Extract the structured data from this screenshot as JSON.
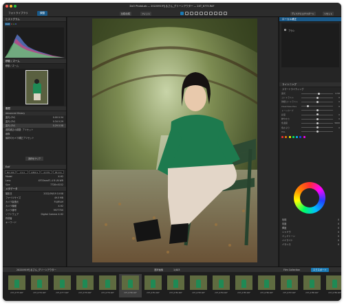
{
  "window": {
    "title": "DxO PhotoLab — 20220919もるさん_グリーンアウター — 2XT_6775.RAF"
  },
  "colors": {
    "accent": "#1a7ab5",
    "tab_active": "#1a5a8a",
    "close": "#ff5f57",
    "minimize": "#febc2e",
    "zoom": "#28c840"
  },
  "tabs": {
    "library": "フォトライブラリ",
    "customize": "調整"
  },
  "toolbar": {
    "compare_label": "比較/比較",
    "fit_label": "フィット",
    "export_to_disk": "ディスクにエクスポート",
    "reset_label": "リセット"
  },
  "left": {
    "histogram_title": "ヒストグラム",
    "histogram_tags": [
      "RGB",
      "R",
      "G",
      "B"
    ],
    "move_zoom_title": "移動 / ズーム",
    "navigator_label": "移動 / ズーム",
    "history_title": "履歴",
    "history_tab": "Advanced History",
    "history_items": [
      {
        "label": "露光 (EV)",
        "a": "0.00",
        "b": "0.34"
      },
      {
        "label": "露光 (EV)",
        "a": "0.34",
        "b": "0.29"
      },
      {
        "label": "露光 (EV)",
        "a": "0.29",
        "b": "0.58"
      },
      {
        "label": "透視補正の調整: プリセット",
        "a": "",
        "b": ""
      },
      {
        "label": "画像",
        "a": "",
        "b": ""
      },
      {
        "label": "最初のカメラ補正プリセット",
        "a": "",
        "b": ""
      }
    ],
    "history_button": "選択をクリア",
    "exif_title": "Exif",
    "exif_fields": [
      "ISO 100",
      "f/1.4",
      "1/800 s",
      "-1/3 EV",
      "85 mm"
    ],
    "exif_lines": [
      {
        "k": "Model",
        "v": "X-H2"
      },
      {
        "k": "Lens",
        "v": "XF33mmF1.4 R LM WR"
      },
      {
        "k": "Size",
        "v": "7728×5152"
      }
    ],
    "info_title": "メタデータ",
    "info_rows": [
      {
        "k": "撮影日",
        "v": "2022/09/19 10:58"
      },
      {
        "k": "ファイルサイズ",
        "v": "49.5 MB"
      },
      {
        "k": "カメラ製造元",
        "v": "FUJIFILM"
      },
      {
        "k": "カメラ機種",
        "v": "X-H2"
      },
      {
        "k": "カメラ番号",
        "v": "9977700"
      },
      {
        "k": "ソフトウェア",
        "v": "Digital Camera X-H2"
      },
      {
        "k": "作成者",
        "v": ""
      },
      {
        "k": "キーワード",
        "v": ""
      }
    ]
  },
  "right": {
    "header_tab": "ローカル補正",
    "local_label": "ブラシ",
    "section_title": "ライトニング",
    "section_sub": "スマートライティング",
    "sliders": [
      {
        "label": "露光",
        "value": "0.58",
        "pos": 0.55
      },
      {
        "label": "コントラスト",
        "value": "0",
        "pos": 0.5
      },
      {
        "label": "微細コントラスト",
        "value": "0",
        "pos": 0.5
      },
      {
        "label": "ClearView Plus",
        "value": "0",
        "pos": 0.2
      },
      {
        "label": "トーンカーブ",
        "value": "",
        "pos": 0.5
      },
      {
        "label": "彩度",
        "value": "0",
        "pos": 0.5
      },
      {
        "label": "鮮やかさ",
        "value": "0",
        "pos": 0.5
      },
      {
        "label": "色温度",
        "value": "5600",
        "pos": 0.5
      },
      {
        "label": "色かぶり",
        "value": "0",
        "pos": 0.5
      },
      {
        "label": "HSL",
        "value": "",
        "pos": 0.5
      }
    ],
    "color_labels": [
      "色相",
      "彩度",
      "輝度"
    ],
    "bottom_rows": [
      {
        "label": "シャドウ",
        "value": "0"
      },
      {
        "label": "ミッドトーン",
        "value": "0"
      },
      {
        "label": "ハイライト",
        "value": "0"
      },
      {
        "label": "バランス",
        "value": "0"
      }
    ]
  },
  "bottom": {
    "folder": "20220919もるさん_グリーンアウター",
    "count": "1/403",
    "selected": "選択画像",
    "filmpack_label": "Film Collection",
    "export_button": "エクスポート"
  },
  "thumbnails": [
    "2XT_6775.RAF",
    "2XT_6776.RAF",
    "2XT_6777.RAF",
    "2XT_6778.RAF",
    "2XT_6779.RAF",
    "2XT_6780.RAF",
    "2XT_6781.RAF",
    "2XT_6782.RAF",
    "2XT_6783.RAF",
    "2XT_6784.RAF",
    "2XT_6785.RAF",
    "2XT_6786.RAF",
    "2XT_6787.RAF",
    "2XT_6788.RAF",
    "2XT_6789.RAF"
  ]
}
